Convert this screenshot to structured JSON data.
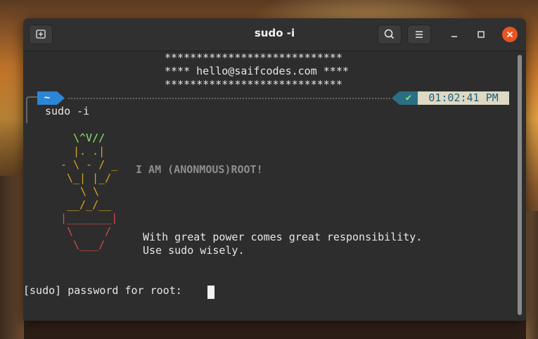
{
  "window": {
    "title": "sudo -i"
  },
  "colors": {
    "accent_close": "#e95420",
    "prompt_home_bg": "#2c86d6",
    "prompt_status_bg": "#2a6f86",
    "prompt_time_bg": "#ddd9c4",
    "ascii_plant": "#8be86a",
    "ascii_pot_top": "#d9a620",
    "ascii_pot": "#e04848"
  },
  "icons": {
    "new_tab": "new-tab-icon",
    "search": "search-icon",
    "menu": "hamburger-menu-icon",
    "minimize": "minimize-icon",
    "maximize": "maximize-icon",
    "close": "close-icon"
  },
  "terminal": {
    "banner": [
      "****************************",
      "**** hello@saifcodes.com ****",
      "****************************"
    ],
    "prompt": {
      "home": "~",
      "status": "✔",
      "time": "01:02:41 PM"
    },
    "command": "sudo -i",
    "art": {
      "plant": [
        "\\^V//",
        "|. .|",
        "- \\ - / _",
        "\\_| |_/",
        "\\ \\",
        "__/_/__"
      ],
      "pot": [
        "|_______|",
        "\\     /",
        "\\___/"
      ],
      "title": "I AM (ANONMOUS)ROOT!",
      "quote": [
        "With great power comes great responsibility.",
        "Use sudo wisely."
      ]
    },
    "password_prompt": "[sudo] password for root: "
  }
}
